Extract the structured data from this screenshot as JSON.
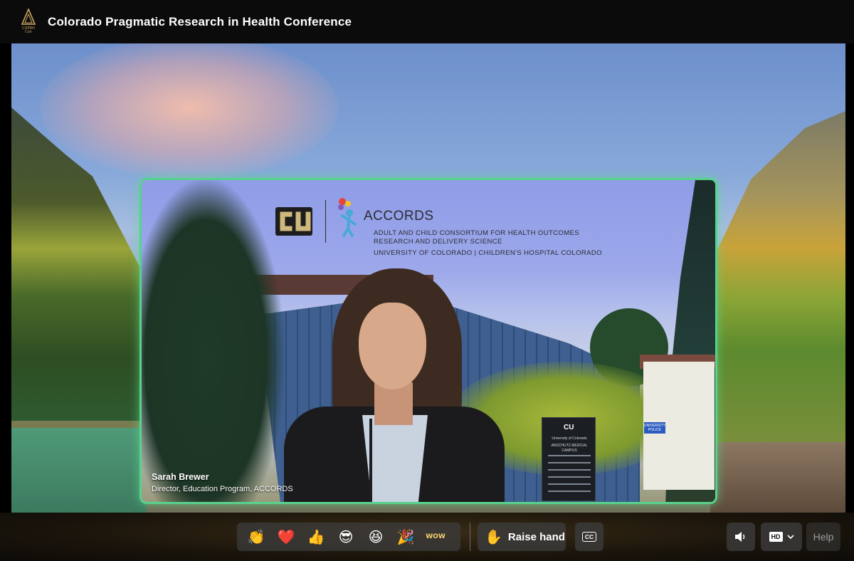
{
  "header": {
    "title": "Colorado Pragmatic Research in Health Conference",
    "logo_text": "COPRH Con"
  },
  "speaker_tile": {
    "name": "Sarah Brewer",
    "role": "Director, Education Program, ACCORDS",
    "highlight_color": "#58d18c",
    "background_brand": {
      "name": "ACCORDS",
      "line1": "ADULT AND CHILD CONSORTIUM FOR HEALTH OUTCOMES",
      "line2": "RESEARCH AND DELIVERY SCIENCE",
      "line3": "UNIVERSITY OF COLORADO  |  CHILDREN'S HOSPITAL COLORADO",
      "cu_logo_text": "CU"
    },
    "sign": {
      "logo": "CU",
      "title": "University of Colorado",
      "campus": "ANSCHUTZ MEDICAL CAMPUS"
    },
    "street_sign": "UNIVERSITY POLICE"
  },
  "toolbar": {
    "reactions": [
      {
        "name": "clap",
        "glyph": "👏"
      },
      {
        "name": "heart",
        "glyph": "❤️"
      },
      {
        "name": "thumbs-up",
        "glyph": "👍"
      },
      {
        "name": "cool",
        "glyph": "😎"
      },
      {
        "name": "laugh",
        "glyph": "😆"
      },
      {
        "name": "party",
        "glyph": "🎉"
      },
      {
        "name": "wow",
        "glyph": "WOW"
      }
    ],
    "raise_hand_label": "Raise hand",
    "raise_hand_icon": "✋",
    "cc_label": "CC",
    "hd_label": "HD",
    "help_label": "Help"
  }
}
